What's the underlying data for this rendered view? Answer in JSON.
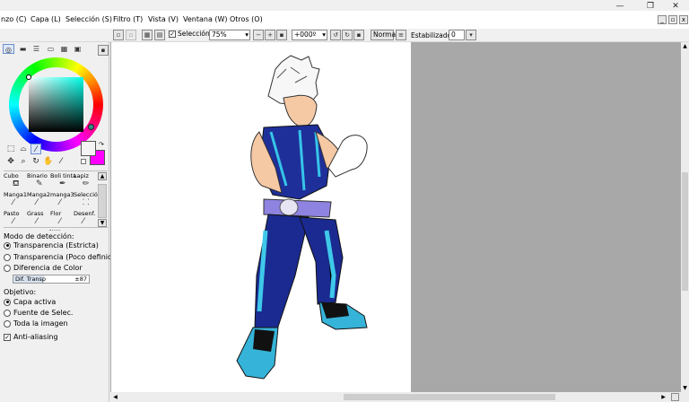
{
  "window": {
    "minimize": "—",
    "restore": "❐",
    "close": "✕"
  },
  "menu": [
    "nzo (C)",
    "Capa (L)",
    "Selección (S)",
    "Filtro (T)",
    "Vista (V)",
    "Ventana (W)",
    "Otros (O)"
  ],
  "toolbar": {
    "selection_label": "Selección",
    "selection_checked": true,
    "zoom_value": "75%",
    "angle_value": "+000º",
    "blend_mode": "Normal",
    "stabilizer_label": "Estabilizador",
    "stabilizer_value": "0"
  },
  "colors": {
    "primary": "#f4f4f4",
    "secondary": "#ff00ff",
    "picked": "#1f7f7a"
  },
  "brushes": [
    {
      "name": "Cubo",
      "icon": "bucket-icon"
    },
    {
      "name": "Binario",
      "icon": "binary-pen-icon"
    },
    {
      "name": "Boli tinta",
      "icon": "ink-pen-icon"
    },
    {
      "name": "Lapiz",
      "icon": "pencil-icon"
    },
    {
      "name": "Manga1",
      "icon": "brush-icon"
    },
    {
      "name": "Manga2",
      "icon": "brush-icon"
    },
    {
      "name": "manga3",
      "icon": "brush-icon"
    },
    {
      "name": "Selecció",
      "icon": "selection-brush-icon"
    },
    {
      "name": "Pasto",
      "icon": "brush-icon"
    },
    {
      "name": "Grass",
      "icon": "brush-icon"
    },
    {
      "name": "Flor",
      "icon": "brush-icon"
    },
    {
      "name": "Desenf.",
      "icon": "blur-icon"
    }
  ],
  "options": {
    "detect_title": "Modo de detección:",
    "detect_modes": [
      "Transparencia (Estricta)",
      "Transparencia (Poco definida)",
      "Diferencia de Color"
    ],
    "detect_selected": 0,
    "diff_label": "Dif. Transp",
    "diff_value": "±87",
    "target_title": "Objetivo:",
    "targets": [
      "Capa activa",
      "Fuente de Selec.",
      "Toda la imagen"
    ],
    "target_selected": 0,
    "antialias_label": "Anti-aliasing",
    "antialias_checked": true
  }
}
